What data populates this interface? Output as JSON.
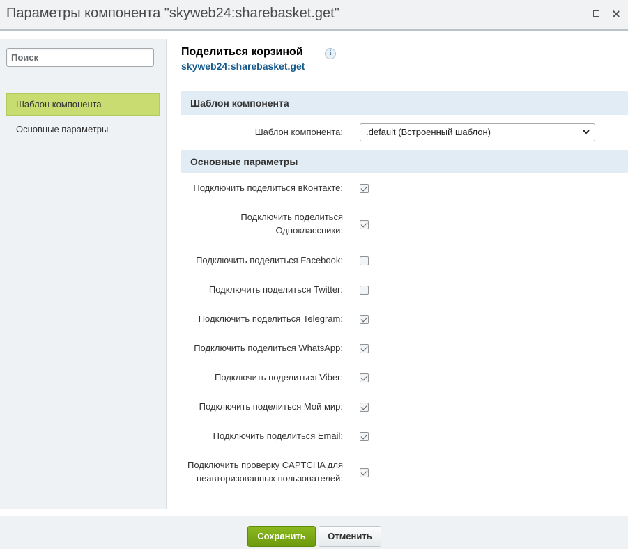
{
  "window": {
    "title": "Параметры компонента \"skyweb24:sharebasket.get\""
  },
  "sidebar": {
    "search_placeholder": "Поиск",
    "items": [
      {
        "label": "Шаблон компонента",
        "active": true
      },
      {
        "label": "Основные параметры",
        "active": false
      }
    ]
  },
  "component": {
    "title": "Поделиться корзиной",
    "info_icon": "info-icon",
    "code": "skyweb24:sharebasket.get"
  },
  "sections": {
    "template": {
      "heading": "Шаблон компонента",
      "label": "Шаблон компонента:",
      "selected": ".default (Встроенный шаблон)"
    },
    "main": {
      "heading": "Основные параметры",
      "options": [
        {
          "label": "Подключить поделиться вКонтакте:",
          "checked": true
        },
        {
          "label": "Подключить поделиться Одноклассники:",
          "checked": true
        },
        {
          "label": "Подключить поделиться Facebook:",
          "checked": false
        },
        {
          "label": "Подключить поделиться Twitter:",
          "checked": false
        },
        {
          "label": "Подключить поделиться Telegram:",
          "checked": true
        },
        {
          "label": "Подключить поделиться WhatsApp:",
          "checked": true
        },
        {
          "label": "Подключить поделиться Viber:",
          "checked": true
        },
        {
          "label": "Подключить поделиться Мой мир:",
          "checked": true
        },
        {
          "label": "Подключить поделиться Email:",
          "checked": true
        },
        {
          "label": "Подключить проверку CAPTCHA для неавторизованных пользователей:",
          "checked": true
        }
      ]
    }
  },
  "footer": {
    "save_label": "Сохранить",
    "cancel_label": "Отменить"
  },
  "colors": {
    "accent_green": "#7aaa14",
    "link_blue": "#175b8d",
    "active_nav": "#c8dc72",
    "section_bg": "#e2ecf4"
  }
}
